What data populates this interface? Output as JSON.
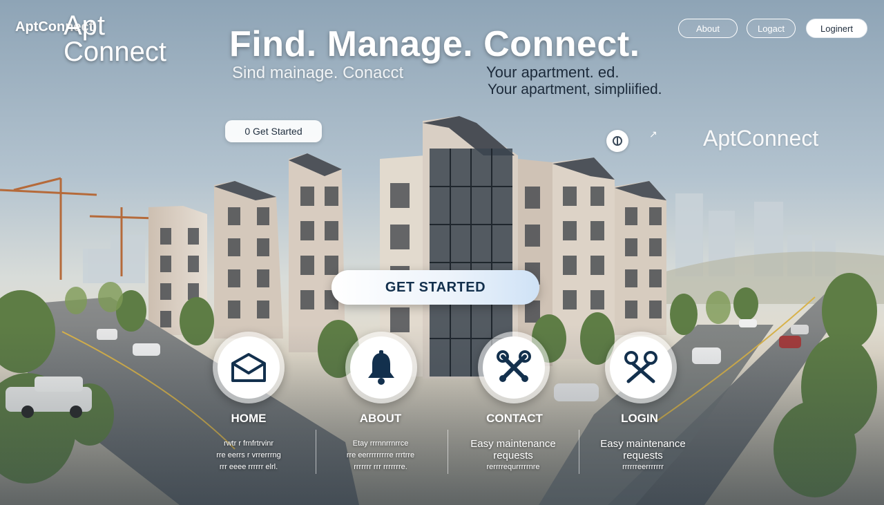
{
  "brand": {
    "small": "AptConnect",
    "small_sub": "",
    "big": "Apt Connect",
    "side": "AptConnect"
  },
  "hero": {
    "headline": "Find. Manage. Connect.",
    "ghost_sub": "Sind mainage.  Conacct",
    "sub_line_1": "Your apartment.         ed.",
    "sub_line_2": "Your apartment, simpliified."
  },
  "nav": {
    "about": "About ",
    "logout": "Logact",
    "login": "Loginert"
  },
  "cta": {
    "small": "0 Get Started",
    "big": "GET STARTED"
  },
  "features": [
    {
      "label": "HOME",
      "icon": "envelope-icon",
      "desc_lines": [
        "rwtr r frnfrtrvinr",
        "rre eerrs r vrrerrrng",
        "rrr eeee rrrrrr elrl."
      ]
    },
    {
      "label": "ABOUT",
      "icon": "bell-icon",
      "desc_lines": [
        "Etay rrrnnrrnrrce",
        "rre eerrrrrrrrre rrrtrre",
        "rrrrrrr rrr rrrrrrre."
      ]
    },
    {
      "label": "CONTACT",
      "icon": "tools-icon",
      "desc_title": "Easy maintenance",
      "desc_lines": [
        "requests",
        "rerrrrequrrrrrnre"
      ]
    },
    {
      "label": "LOGIN",
      "icon": "scissors-icon",
      "desc_title": "Easy maintenance",
      "desc_lines": [
        "requests",
        "rrrrrreerrrrrrr"
      ]
    }
  ],
  "colors": {
    "sky_top": "#8fa6b8",
    "building": "#dcd3c9",
    "cta_text": "#13304d"
  }
}
